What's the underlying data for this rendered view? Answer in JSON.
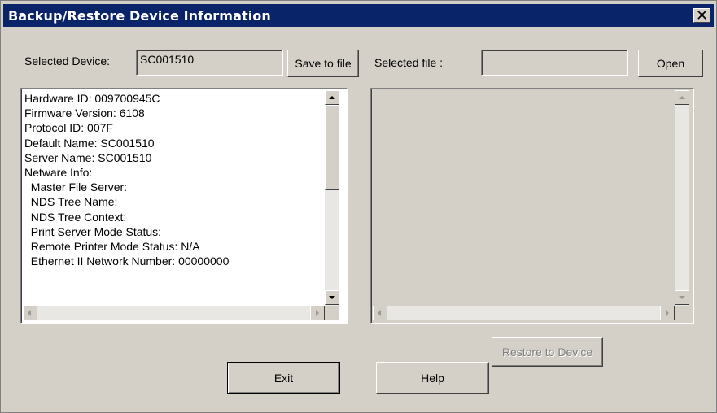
{
  "window": {
    "title": "Backup/Restore Device Information"
  },
  "device": {
    "label": "Selected Device:",
    "value": "SC001510",
    "save_label": "Save to file"
  },
  "file": {
    "label": "Selected file :",
    "value": "",
    "open_label": "Open"
  },
  "info_lines": [
    "Hardware ID: 009700945C",
    "Firmware Version: 6108",
    "Protocol ID: 007F",
    "Default Name: SC001510",
    "Server Name: SC001510",
    "Netware Info:",
    "  Master File Server:",
    "  NDS Tree Name:",
    "  NDS Tree Context:",
    "  Print Server Mode Status:",
    "  Remote Printer Mode Status: N/A",
    "  Ethernet II Network Number: 00000000"
  ],
  "buttons": {
    "restore": "Restore to Device",
    "exit": "Exit",
    "help": "Help"
  }
}
